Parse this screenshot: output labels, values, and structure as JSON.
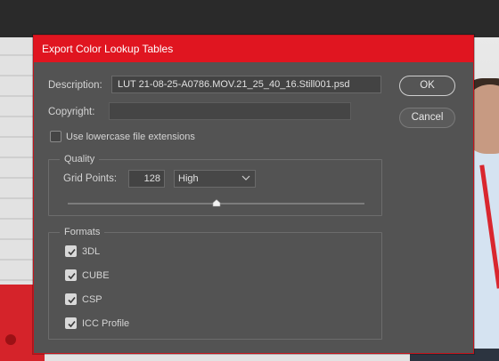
{
  "dialog": {
    "title": "Export Color Lookup Tables",
    "description_label": "Description:",
    "description_value": "LUT 21-08-25-A0786.MOV.21_25_40_16.Still001.psd",
    "copyright_label": "Copyright:",
    "copyright_value": "",
    "lowercase_label": "Use lowercase file extensions",
    "lowercase_checked": false,
    "ok_label": "OK",
    "cancel_label": "Cancel"
  },
  "quality": {
    "title": "Quality",
    "grid_points_label": "Grid Points:",
    "grid_points_value": "128",
    "preset_selected": "High",
    "slider_fraction": 0.5
  },
  "formats": {
    "title": "Formats",
    "items": [
      {
        "label": "3DL",
        "checked": true
      },
      {
        "label": "CUBE",
        "checked": true
      },
      {
        "label": "CSP",
        "checked": true
      },
      {
        "label": "ICC Profile",
        "checked": true
      }
    ]
  },
  "colors": {
    "title_bar": "#e01520",
    "dialog_bg": "#535353",
    "accent_border": "#c5131b"
  }
}
